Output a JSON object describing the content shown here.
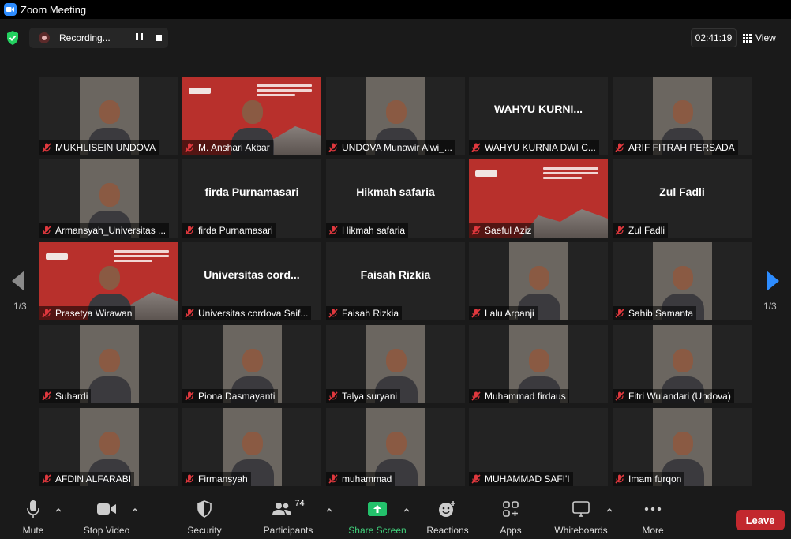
{
  "window": {
    "title": "Zoom Meeting"
  },
  "recording": {
    "label": "Recording..."
  },
  "timer": "02:41:19",
  "view_label": "View",
  "page_indicator_left": "1/3",
  "page_indicator_right": "1/3",
  "participants": [
    {
      "name": "MUKHLISEIN UNDOVA",
      "type": "video"
    },
    {
      "name": "M. Anshari Akbar",
      "type": "slide-video",
      "active": true
    },
    {
      "name": "UNDOVA Munawir Alwi_...",
      "type": "video"
    },
    {
      "name": "WAHYU KURNIA DWI C...",
      "display": "WAHYU  KURNI...",
      "type": "name"
    },
    {
      "name": "ARIF FITRAH PERSADA",
      "type": "video"
    },
    {
      "name": "Armansyah_Universitas ...",
      "type": "video"
    },
    {
      "name": "firda Purnamasari",
      "display": "firda Purnamasari",
      "type": "name"
    },
    {
      "name": "Hikmah safaria",
      "display": "Hikmah safaria",
      "type": "name"
    },
    {
      "name": "Saeful Aziz",
      "type": "slide"
    },
    {
      "name": "Zul Fadli",
      "display": "Zul Fadli",
      "type": "name"
    },
    {
      "name": "Prasetya Wirawan",
      "type": "slide-video"
    },
    {
      "name": "Universitas cordova Saif...",
      "display": "Universitas  cord...",
      "type": "name"
    },
    {
      "name": "Faisah Rizkia",
      "display": "Faisah Rizkia",
      "type": "name"
    },
    {
      "name": "Lalu Arpanji",
      "type": "video"
    },
    {
      "name": "Sahib Samanta",
      "type": "video"
    },
    {
      "name": "Suhardi",
      "type": "video"
    },
    {
      "name": "Piona Dasmayanti",
      "type": "video"
    },
    {
      "name": "Talya suryani",
      "type": "video"
    },
    {
      "name": "Muhammad firdaus",
      "type": "video"
    },
    {
      "name": "Fitri Wulandari (Undova)",
      "type": "video"
    },
    {
      "name": "AFDIN ALFARABI",
      "type": "video"
    },
    {
      "name": "Firmansyah",
      "type": "video"
    },
    {
      "name": "muhammad",
      "type": "video"
    },
    {
      "name": "MUHAMMAD SAFI'I",
      "type": "blank"
    },
    {
      "name": "Imam furqon",
      "type": "video"
    }
  ],
  "toolbar": {
    "mute": "Mute",
    "stop_video": "Stop Video",
    "security": "Security",
    "participants": "Participants",
    "participants_count": "74",
    "share_screen": "Share Screen",
    "reactions": "Reactions",
    "apps": "Apps",
    "whiteboards": "Whiteboards",
    "more": "More",
    "leave": "Leave"
  },
  "colors": {
    "active_speaker_border": "#e3e56a",
    "share_green": "#41d07b",
    "leave_red": "#c2282e",
    "muted_icon": "#e0383e"
  }
}
